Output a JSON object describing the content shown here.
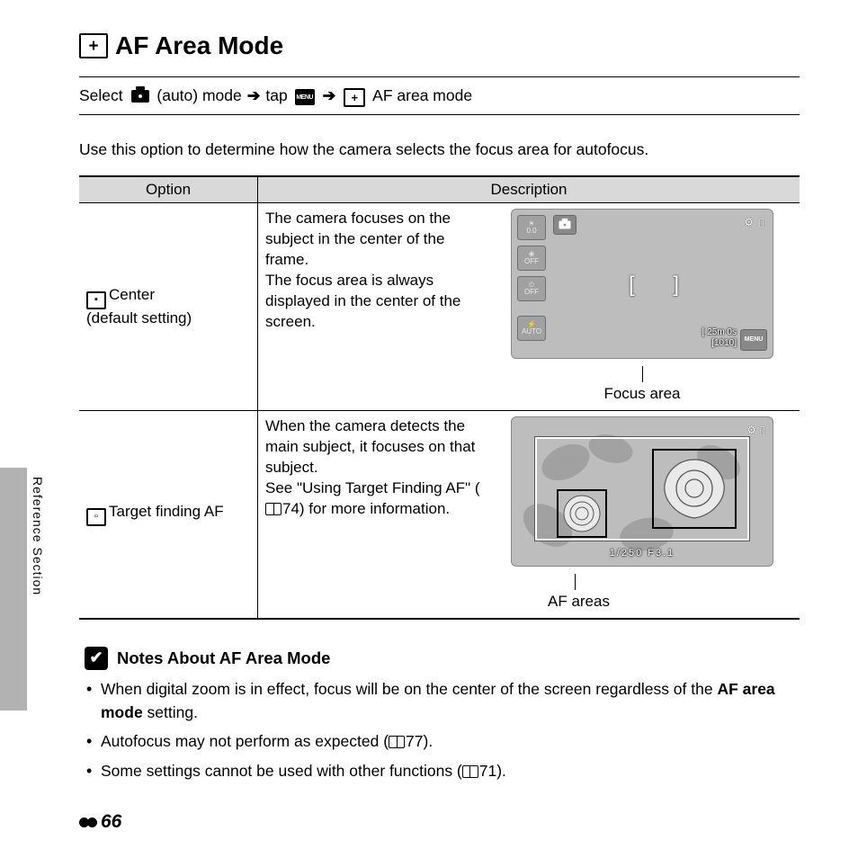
{
  "sidebar_label": "Reference Section",
  "title": "AF Area Mode",
  "nav": {
    "select": "Select",
    "auto_mode": "(auto) mode",
    "tap": "tap",
    "af_area_mode": "AF area mode",
    "menu_label": "MENU"
  },
  "intro": "Use this option to determine how the camera selects the focus area for autofocus.",
  "table": {
    "header_option": "Option",
    "header_description": "Description",
    "rows": [
      {
        "icon_glyph": "▪",
        "option": "Center",
        "option_sub": "(default setting)",
        "desc1": "The camera focuses on the subject in the center of the frame.",
        "desc2": "The focus area is always displayed in the center of the screen.",
        "caption": "Focus area"
      },
      {
        "icon_glyph": "▫",
        "option": "Target finding AF",
        "desc1": "When the camera detects the main subject, it focuses on that subject.",
        "desc2_prefix": "See \"Using Target Finding AF\" (",
        "desc2_ref": "74",
        "desc2_suffix": ") for more information.",
        "caption": "AF areas"
      }
    ]
  },
  "lcd1": {
    "side_buttons": [
      "0.0",
      "OFF",
      "OFF",
      "AUTO"
    ],
    "info_line1": "25m 0s",
    "info_line2": "[1010]",
    "indicator_label": "[",
    "menu_label": "MENU"
  },
  "lcd2": {
    "bottom_text": "1/250   F3.1"
  },
  "notes": {
    "heading": "Notes About AF Area Mode",
    "items": [
      {
        "pre": "When digital zoom is in effect, focus will be on the center of the screen regardless of the ",
        "bold": "AF area mode",
        "post": " setting."
      },
      {
        "pre": "Autofocus may not perform as expected (",
        "ref": "77",
        "post": ")."
      },
      {
        "pre": "Some settings cannot be used with other functions (",
        "ref": "71",
        "post": ")."
      }
    ]
  },
  "page_no": "66",
  "chart_data": null
}
